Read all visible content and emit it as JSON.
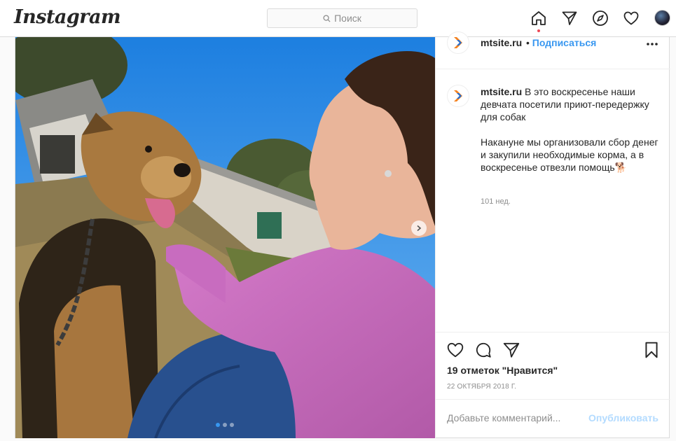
{
  "app": {
    "logo": "Instagram"
  },
  "search": {
    "placeholder": "Поиск"
  },
  "nav": {
    "icons": [
      "home-icon",
      "direct-icon",
      "explore-icon",
      "activity-heart-icon",
      "profile-avatar"
    ],
    "active_indicator_color": "#ed4956"
  },
  "post": {
    "username": "mtsite.ru",
    "separator": "•",
    "follow_label": "Подписаться",
    "caption_username": "mtsite.ru",
    "caption_line1": "В это воскресенье наши девчата посетили приют-передержку для собак",
    "caption_line2": "Накануне мы организовали сбор денег и закупили необходимые корма, а в воскресенье отвезли помощь🐕",
    "time_ago": "101 нед.",
    "likes": "19 отметок \"Нравится\"",
    "date": "22 ОКТЯБРЯ 2018 Г.",
    "comment_placeholder": "Добавьте комментарий...",
    "publish_label": "Опубликовать",
    "carousel": {
      "total": 3,
      "current": 1
    }
  },
  "colors": {
    "accent": "#3897f0",
    "publish_disabled": "#b3dbff",
    "brand_orange": "#f5821f",
    "brand_blue": "#1e6fd9"
  }
}
